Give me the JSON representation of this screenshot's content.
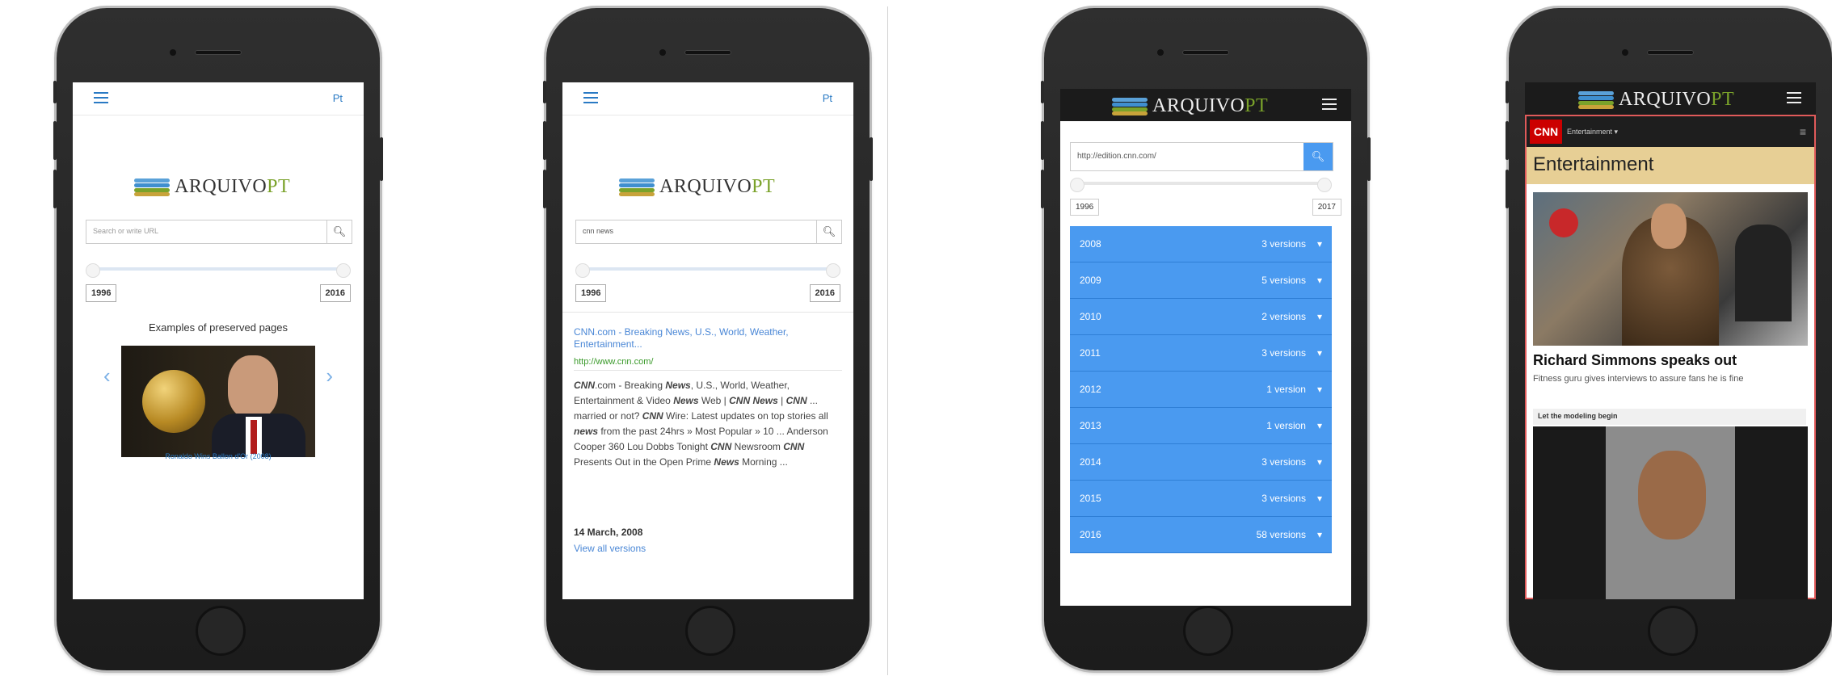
{
  "common": {
    "brand_main": "ARQUIVO",
    "brand_accent": "PT"
  },
  "phone1": {
    "lang": "Pt",
    "search_placeholder": "Search or write URL",
    "year_start": "1996",
    "year_end": "2016",
    "examples_title": "Examples of preserved pages",
    "carousel_caption": "Ronaldo Wins Ballon d'Or (2008)"
  },
  "phone2": {
    "lang": "Pt",
    "search_value": "cnn news",
    "year_start": "1996",
    "year_end": "2016",
    "result_title": "CNN.com - Breaking News, U.S., World, Weather, Entertainment...",
    "result_url": "http://www.cnn.com/",
    "snippet": [
      {
        "t": "CNN",
        "b": true
      },
      {
        "t": ".com - Breaking ",
        "b": false
      },
      {
        "t": "News",
        "b": true
      },
      {
        "t": ", U.S., World, Weather, Entertainment & Video ",
        "b": false
      },
      {
        "t": "News",
        "b": true
      },
      {
        "t": " Web | ",
        "b": false
      },
      {
        "t": "CNN News",
        "b": true
      },
      {
        "t": " | ",
        "b": false
      },
      {
        "t": "CNN",
        "b": true
      },
      {
        "t": " ... married or not? ",
        "b": false
      },
      {
        "t": "CNN",
        "b": true
      },
      {
        "t": " Wire: Latest updates on top stories all ",
        "b": false
      },
      {
        "t": "news",
        "b": true
      },
      {
        "t": " from the past 24hrs » Most Popular » 10 ... Anderson Cooper 360 Lou Dobbs Tonight ",
        "b": false
      },
      {
        "t": "CNN",
        "b": true
      },
      {
        "t": " Newsroom ",
        "b": false
      },
      {
        "t": "CNN",
        "b": true
      },
      {
        "t": " Presents Out in the Open Prime ",
        "b": false
      },
      {
        "t": "News",
        "b": true
      },
      {
        "t": " Morning ...",
        "b": false
      }
    ],
    "result_date": "14 March, 2008",
    "all_versions_link": "View all versions"
  },
  "phone3": {
    "url_value": "http://edition.cnn.com/",
    "year_start": "1996",
    "year_end": "2017",
    "versions": [
      {
        "year": "2008",
        "count": "3 versions"
      },
      {
        "year": "2009",
        "count": "5 versions"
      },
      {
        "year": "2010",
        "count": "2 versions"
      },
      {
        "year": "2011",
        "count": "3 versions"
      },
      {
        "year": "2012",
        "count": "1 version"
      },
      {
        "year": "2013",
        "count": "1 version"
      },
      {
        "year": "2014",
        "count": "3 versions"
      },
      {
        "year": "2015",
        "count": "3 versions"
      },
      {
        "year": "2016",
        "count": "58 versions"
      }
    ]
  },
  "phone4": {
    "cnn_logo": "CNN",
    "section_menu": "Entertainment ▾",
    "section_title": "Entertainment",
    "headline": "Richard Simmons speaks out",
    "subhead": "Fitness guru gives interviews to assure fans he is fine",
    "second_label": "Let the modeling begin"
  },
  "colors": {
    "accent_blue": "#4a9af0",
    "link_blue": "#2a7ac4",
    "url_green": "#3a9a2a",
    "cnn_red": "#cc0000"
  }
}
